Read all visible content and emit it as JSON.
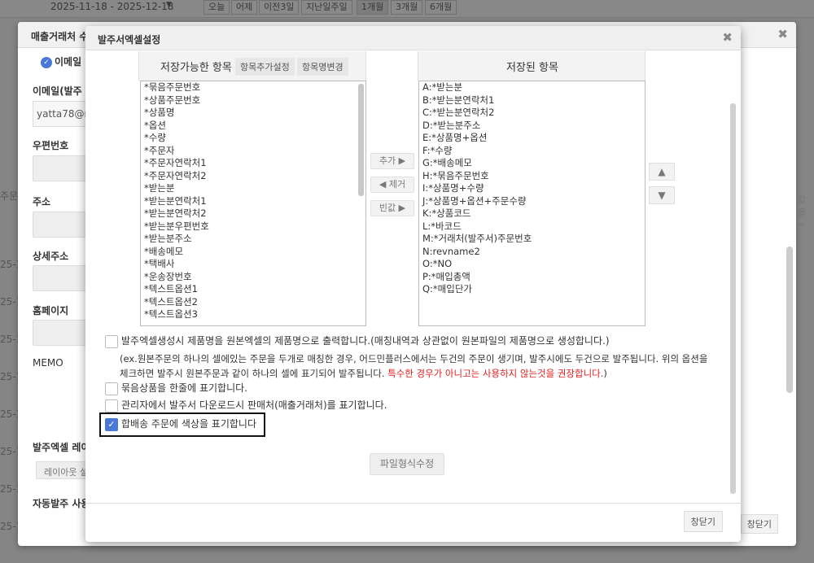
{
  "background": {
    "date_range": "2025-11-18 - 2025-12-18",
    "date_chips": [
      "오늘",
      "어제",
      "이전3일",
      "지난일주일",
      "1개월",
      "3개월",
      "6개월"
    ],
    "left_labels": [
      "주문",
      "25-1",
      "25-1",
      "25-1",
      "25-1",
      "25-1",
      "25-1",
      "25-1",
      "25-1",
      "25-1"
    ],
    "right_labels": [
      "값을 ="
    ]
  },
  "outer_modal": {
    "title": "매출거래처 수",
    "radio_email": "이메일",
    "email_label": "이메일(발주",
    "email_value": "yatta78@na",
    "postal_label": "우편번호",
    "address_label": "주소",
    "detail_address_label": "상세주소",
    "homepage_label": "홈페이지",
    "memo_label": "MEMO",
    "layout_label": "발주엑셀 레이",
    "layout_button": "레이아웃 설",
    "auto_label": "자동발주 사용",
    "close_button": "창닫기",
    "close_icon": "✖"
  },
  "dialog": {
    "title": "발주서엑셀설정",
    "close_icon": "✖",
    "available_title": "저장가능한 항목",
    "btn_add_item_setting": "항목추가설정",
    "btn_rename_item": "항목명변경",
    "saved_title": "저장된 항목",
    "available_items": [
      "*묶음주문번호",
      "*상품주문번호",
      "*상품명",
      "*옵션",
      "*수량",
      "*주문자",
      "*주문자연락처1",
      "*주문자연락처2",
      "*받는분",
      "*받는분연락처1",
      "*받는분연락처2",
      "*받는분우편번호",
      "*받는분주소",
      "*배송메모",
      "*택배사",
      "*운송장번호",
      "*텍스트옵션1",
      "*텍스트옵션2",
      "*텍스트옵션3"
    ],
    "saved_items": [
      "A:*받는분",
      "B:*받는분연락처1",
      "C:*받는분연락처2",
      "D:*받는분주소",
      "E:*상품명+옵션",
      "F:*수량",
      "G:*배송메모",
      "H:*묶음주문번호",
      "I:*상품명+수량",
      "J:*상품명+옵션+주문수량",
      "K:*상품코드",
      "L:*바코드",
      "M:*거래처(발주서)주문번호",
      "N:revname2",
      "O:*NO",
      "P:*매입총액",
      "Q:*매입단가"
    ],
    "btn_add": "추가 ▶",
    "btn_remove": "◀ 제거",
    "btn_blank": "빈값 ▶",
    "btn_up": "▲",
    "btn_down": "▼",
    "option1": "발주엑셀생성시 제품명을 원본엑셀의 제품명으로 출력합니다.(매칭내역과 상관없이 원본파일의 제품명으로 생성합니다.)",
    "option1_note_line1": "(ex.원본주문의 하나의 셀에있는 주문을 두개로 매칭한 경우, 어드민플러스에서는 두건의 주문이 생기며, 발주시에도 두건으로 발주됩니다. 위의 옵션을",
    "option1_note_line2a": "체크하면 발주시 원본주문과 같이 하나의 셀에 표기되어 발주됩니다. ",
    "option1_note_warn": "특수한 경우가 아니고는 사용하지 않는것을 권장합니다.",
    "option1_note_end": ")",
    "option2": "묶음상품을 한줄에 표기합니다.",
    "option3": "관리자에서 발주서 다운로드시 판매처(매출거래처)를 표기합니다.",
    "option4": "합배송 주문에 색상을 표기합니다",
    "check_mark": "✓",
    "btn_edit_format": "파일형식수정",
    "btn_close": "창닫기"
  }
}
